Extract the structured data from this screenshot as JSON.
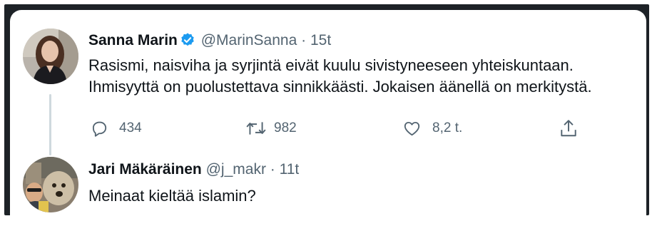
{
  "tweet": {
    "author_name": "Sanna Marin",
    "handle": "@MarinSanna",
    "separator": "·",
    "time": "15t",
    "verified": true,
    "text_line1": "Rasismi, naisviha ja syrjintä eivät kuulu sivistyneeseen yhteiskuntaan.",
    "text_line2": "Ihmisyyttä on puolustettava sinnikkäästi. Jokaisen äänellä on merkitystä.",
    "actions": {
      "reply_icon": "reply-icon",
      "reply_count": "434",
      "retweet_icon": "retweet-icon",
      "retweet_count": "982",
      "like_icon": "heart-icon",
      "like_count": "8,2 t.",
      "share_icon": "share-icon"
    }
  },
  "reply": {
    "author_name": "Jari Mäkäräinen",
    "handle": "@j_makr",
    "separator": "·",
    "time": "11t",
    "text": "Meinaat kieltää islamin?"
  },
  "colors": {
    "verified_badge": "#1d9bf0",
    "secondary_text": "#536471",
    "primary_text": "#0f1419"
  }
}
